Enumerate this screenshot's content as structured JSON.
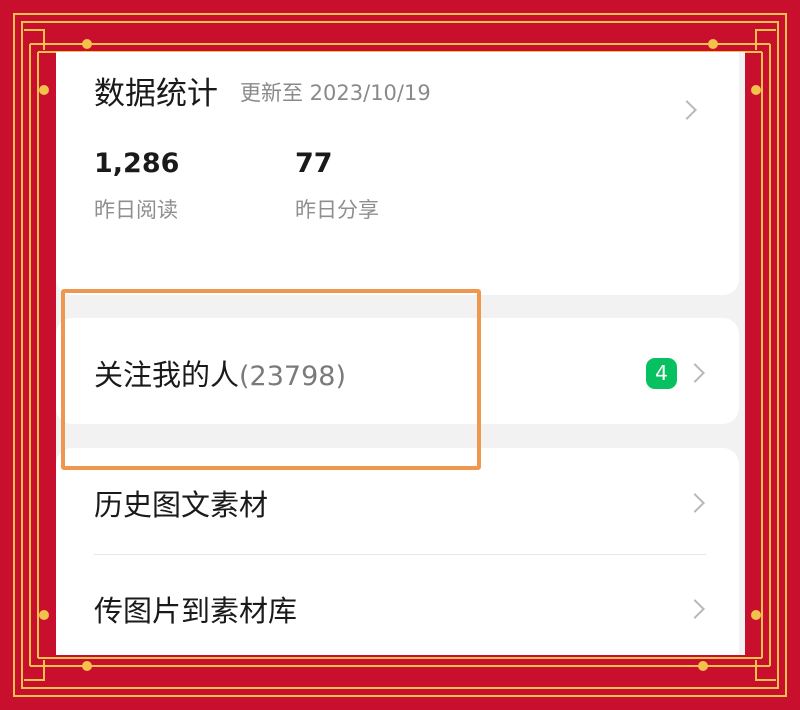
{
  "stats": {
    "title": "数据统计",
    "updated": "更新至 2023/10/19",
    "metrics": [
      {
        "value": "1,286",
        "label": "昨日阅读"
      },
      {
        "value": "77",
        "label": "昨日分享"
      }
    ]
  },
  "followers": {
    "label": "关注我的人",
    "count": "(23798)",
    "badge": "4"
  },
  "menu": {
    "items": [
      {
        "label": "历史图文素材"
      },
      {
        "label": "传图片到素材库"
      }
    ]
  },
  "colors": {
    "frame_red": "#c8102e",
    "frame_gold": "#f2c24d",
    "badge_green": "#07c160",
    "highlight_orange": "#f0974f"
  }
}
